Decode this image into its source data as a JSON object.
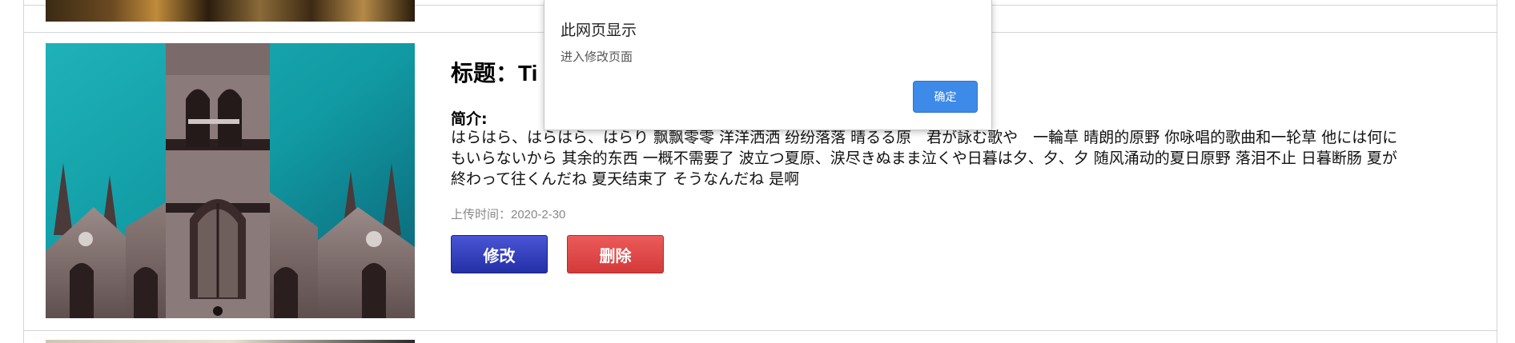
{
  "item": {
    "title": "标题：Ti",
    "intro_label": "简介:",
    "intro_text": "はらはら、はらはら、はらり 飘飘零零 洋洋洒洒 纷纷落落 晴るる原　君が詠む歌や　一輪草 晴朗的原野 你咏唱的歌曲和一轮草 他には何にもいらないから 其余的东西 一概不需要了 波立つ夏原、涙尽きぬまま泣くや日暮は夕、夕、夕 随风涌动的夏日原野 落泪不止 日暮断肠 夏が終わって往くんだね 夏天结束了 そうなんだね 是啊",
    "upload_time": "上传时间：2020-2-30",
    "edit_label": "修改",
    "delete_label": "删除"
  },
  "dialog": {
    "title": "此网页显示",
    "message": "进入修改页面",
    "ok_label": "确定"
  },
  "colors": {
    "edit_button": "#2f3bc0",
    "delete_button": "#e04a4a",
    "dialog_ok": "#3d8ae8"
  }
}
